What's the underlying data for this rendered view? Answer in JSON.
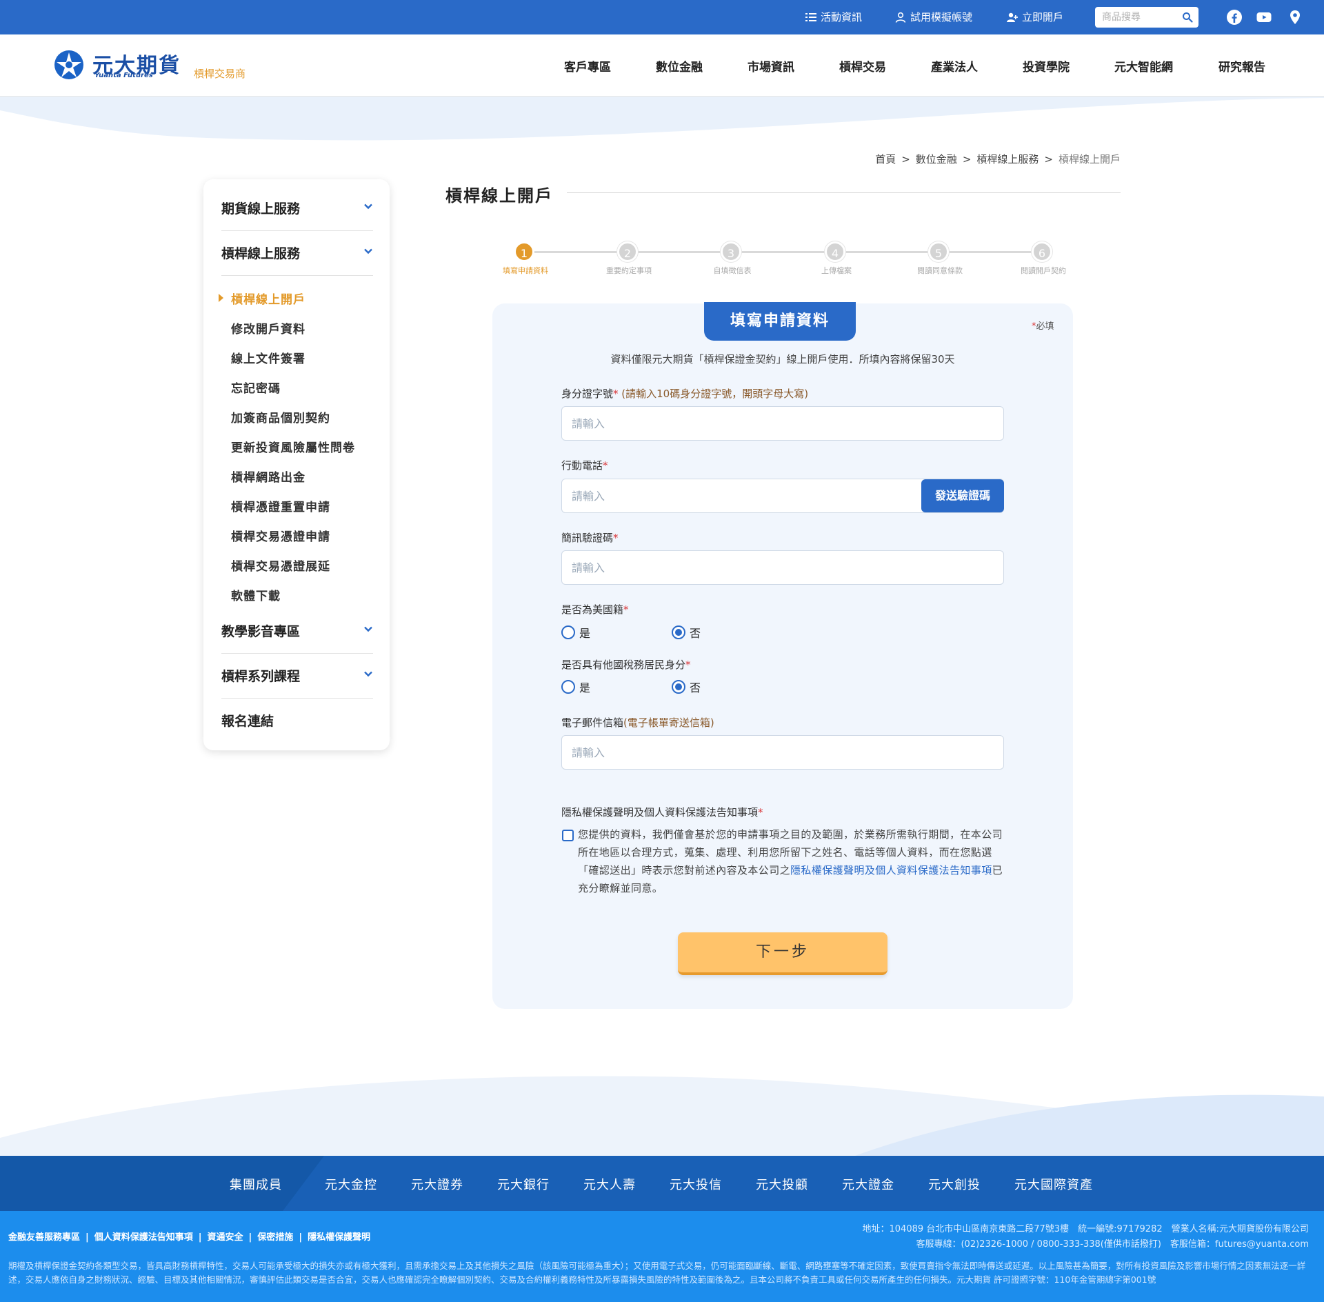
{
  "topbar": {
    "links": [
      "活動資訊",
      "試用模擬帳號",
      "立即開戶"
    ],
    "search_placeholder": "商品搜尋"
  },
  "header": {
    "logo_text": "元大期貨",
    "logo_sub": "Yuanta Futures",
    "logo_tag": "槓桿交易商",
    "nav": [
      "客戶專區",
      "數位金融",
      "市場資訊",
      "槓桿交易",
      "產業法人",
      "投資學院",
      "元大智能網",
      "研究報告"
    ]
  },
  "breadcrumb": [
    "首頁",
    "數位金融",
    "槓桿線上服務",
    "槓桿線上開戶"
  ],
  "sidebar": {
    "sections": [
      "期貨線上服務",
      "槓桿線上服務",
      "教學影音專區",
      "槓桿系列課程",
      "報名連結"
    ],
    "items": [
      "槓桿線上開戶",
      "修改開戶資料",
      "線上文件簽署",
      "忘記密碼",
      "加簽商品個別契約",
      "更新投資風險屬性問卷",
      "槓桿網路出金",
      "槓桿憑證重置申請",
      "槓桿交易憑證申請",
      "槓桿交易憑證展延",
      "軟體下載"
    ]
  },
  "page_title": "槓桿線上開戶",
  "steps": [
    {
      "num": "1",
      "label": "填寫申請資料"
    },
    {
      "num": "2",
      "label": "重要約定事項"
    },
    {
      "num": "3",
      "label": "自填徵信表"
    },
    {
      "num": "4",
      "label": "上傳檔案"
    },
    {
      "num": "5",
      "label": "閱讀同意條款"
    },
    {
      "num": "6",
      "label": "閱讀開戶契約"
    }
  ],
  "form": {
    "tab_title": "填寫申請資料",
    "required_mark": "*",
    "required_text": "必填",
    "intro": "資料僅限元大期貨「槓桿保證金契約」線上開戶使用．所填內容將保留30天",
    "id_label": "身分證字號",
    "id_hint": " (請輸入10碼身分證字號，開頭字母大寫)",
    "mobile_label": "行動電話",
    "send_code": "發送驗證碼",
    "sms_label": "簡訊驗證碼",
    "us_label": "是否為美國籍",
    "tax_label": "是否具有他國稅務居民身分",
    "yes": "是",
    "no": "否",
    "email_label": "電子郵件信箱",
    "email_hint": "(電子帳單寄送信箱)",
    "placeholder": "請輸入",
    "privacy_label": "隱私權保護聲明及個人資料保護法告知事項",
    "privacy_text_1": "您提供的資料，我們僅會基於您的申請事項之目的及範圍，於業務所需執行期間，在本公司所在地區以合理方式，蒐集、處理、利用您所留下之姓名、電話等個人資料，而在您點選「確認送出」時表示您對前述內容及本公司之",
    "privacy_link": "隱私權保護聲明及個人資料保護法告知事項",
    "privacy_text_2": "已充分瞭解並同意。",
    "next": "下一步"
  },
  "footer": {
    "group_label": "集團成員",
    "members": [
      "元大金控",
      "元大證券",
      "元大銀行",
      "元大人壽",
      "元大投信",
      "元大投顧",
      "元大證金",
      "元大創投",
      "元大國際資產"
    ],
    "links": [
      "金融友善服務專區",
      "個人資料保護法告知事項",
      "資通安全",
      "保密措施",
      "隱私權保護聲明"
    ],
    "address": "地址：104089 台北市中山區南京東路二段77號3樓　統一編號:97179282　營業人名稱:元大期貨股份有限公司",
    "contact": "客服專線：(02)2326-1000 / 0800-333-338(僅供市話撥打)　客服信箱：futures@yuanta.com",
    "disclaimer": "期權及槓桿保證金契約各類型交易，皆具高財務槓桿特性，交易人可能承受極大的損失亦或有極大獲利，且需承擔交易上及其他損失之風險（該風險可能極為重大）；又使用電子式交易，仍可能面臨斷線、斷電、網路壅塞等不確定因素，致使買賣指令無法即時傳送或延遲。以上風險甚為簡要，對所有投資風險及影響市場行情之因素無法逐一詳述，交易人應依自身之財務狀況、經驗、目標及其他相關情況，審慎評估此類交易是否合宜，交易人也應確認完全瞭解個別契約、交易及合約權利義務特性及所暴露損失風險的特性及範圍後為之。且本公司將不負責工具或任何交易所產生的任何損失。元大期貨 許可證照字號：110年金管期總字第001號"
  },
  "colors": {
    "brand_blue": "#2a6ac8",
    "accent_orange": "#e39a2a",
    "button_yellow": "#ffc36a",
    "footer_blue": "#1c8ded"
  }
}
